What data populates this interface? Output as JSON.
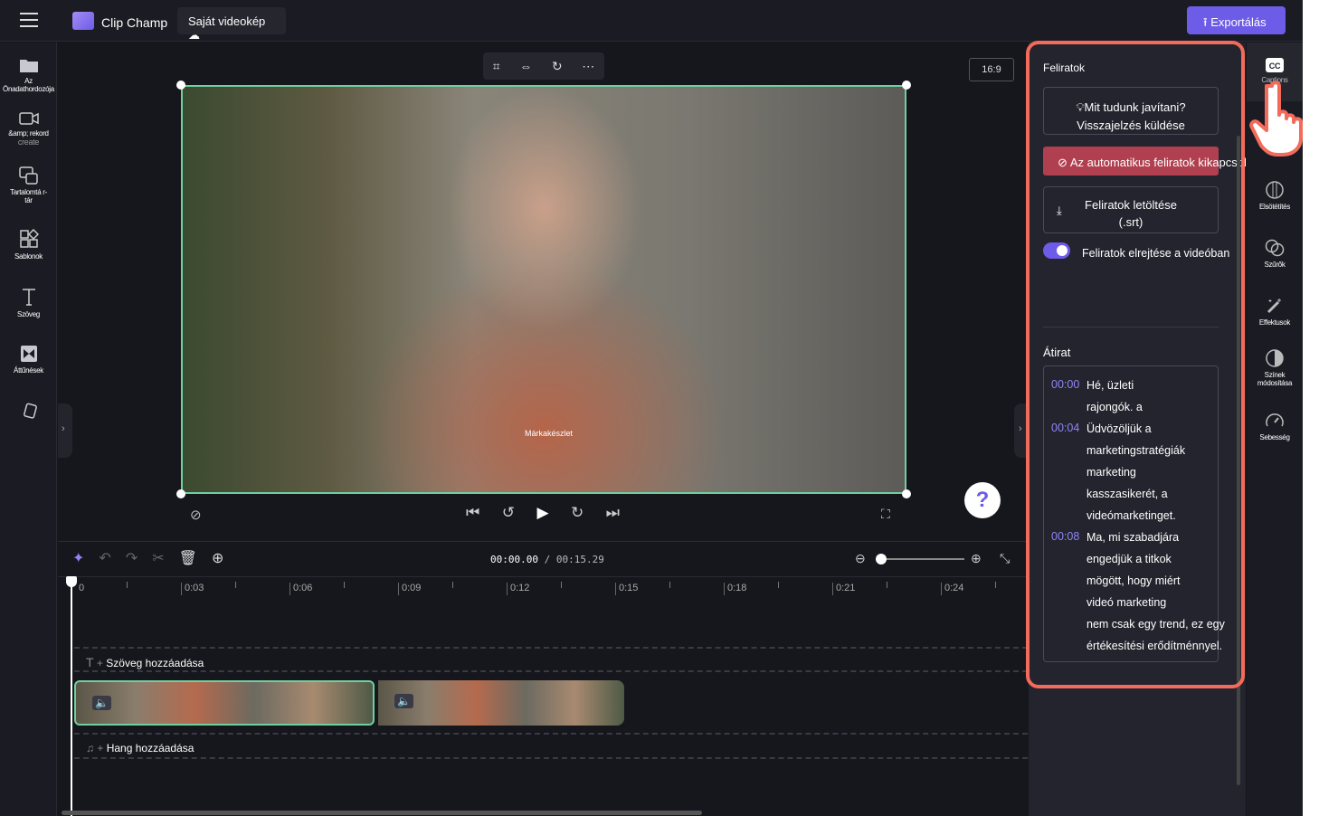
{
  "topbar": {
    "app_name": "Clip Champ",
    "project_title": "Saját videokép",
    "export_label": "Exportálás"
  },
  "sidebar": {
    "items": [
      {
        "label": "Az Önadathordozója",
        "icon": "folder-icon"
      },
      {
        "label": "&amp; rekord",
        "sublabel": "create",
        "icon": "camera-icon"
      },
      {
        "label": "Tartalomtá r-tár",
        "icon": "content-library-icon"
      },
      {
        "label": "Sablonok",
        "icon": "templates-icon"
      },
      {
        "label": "Szöveg",
        "icon": "text-icon"
      },
      {
        "label": "Áttűnések",
        "icon": "transitions-icon"
      },
      {
        "label": "",
        "icon": "stickers-icon"
      }
    ]
  },
  "preview": {
    "aspect_ratio": "16:9",
    "watermark": "Márkakészlet"
  },
  "timeline": {
    "current_time": "00:00.00",
    "total_time": "/ 00:15.29",
    "ruler": [
      "0",
      "0:03",
      "0:06",
      "0:09",
      "0:12",
      "0:15",
      "0:18",
      "0:21",
      "0:24"
    ],
    "add_text": "Szöveg hozzáadása",
    "add_audio": "Hang hozzáadása"
  },
  "captions_panel": {
    "title": "Feliratok",
    "feedback_line1": "Mit tudunk javítani?",
    "feedback_line2": "Visszajelzés küldése",
    "disable_auto": "Az automatikus feliratok kikapcsolása",
    "download_line1": "Feliratok letöltése",
    "download_line2": "(.srt)",
    "hide_toggle_label": "Feliratok elrejtése a videóban",
    "hide_toggle_on": true,
    "transcript_title": "Átirat",
    "transcript": [
      {
        "time": "00:00",
        "lines": [
          "Hé, üzleti",
          "rajongók. a"
        ]
      },
      {
        "time": "00:04",
        "lines": [
          "Üdvözöljük a",
          "marketingstratégiák",
          "marketing",
          "kasszasikerét, a",
          "videómarketinget."
        ]
      },
      {
        "time": "00:08",
        "lines": [
          "Ma, mi szabadjára",
          "engedjük a titkok",
          "mögött, hogy miért",
          "videó marketing",
          "nem csak egy trend, ez egy",
          "értékesítési erődítménnyel."
        ]
      }
    ]
  },
  "rail": {
    "items": [
      {
        "label": "Captions",
        "icon": "cc-icon"
      },
      {
        "label": "Elsötétítés",
        "icon": "fade-icon"
      },
      {
        "label": "Szűrők",
        "icon": "filters-icon"
      },
      {
        "label": "Effektusok",
        "icon": "effects-icon"
      },
      {
        "label": "Színek módosítása",
        "icon": "color-adjust-icon"
      },
      {
        "label": "Sebesség",
        "icon": "speed-icon"
      }
    ]
  },
  "colors": {
    "accent": "#6c5ce7",
    "highlight": "#f26b5b",
    "danger": "#b0404f",
    "selection": "#6fcf9f"
  }
}
